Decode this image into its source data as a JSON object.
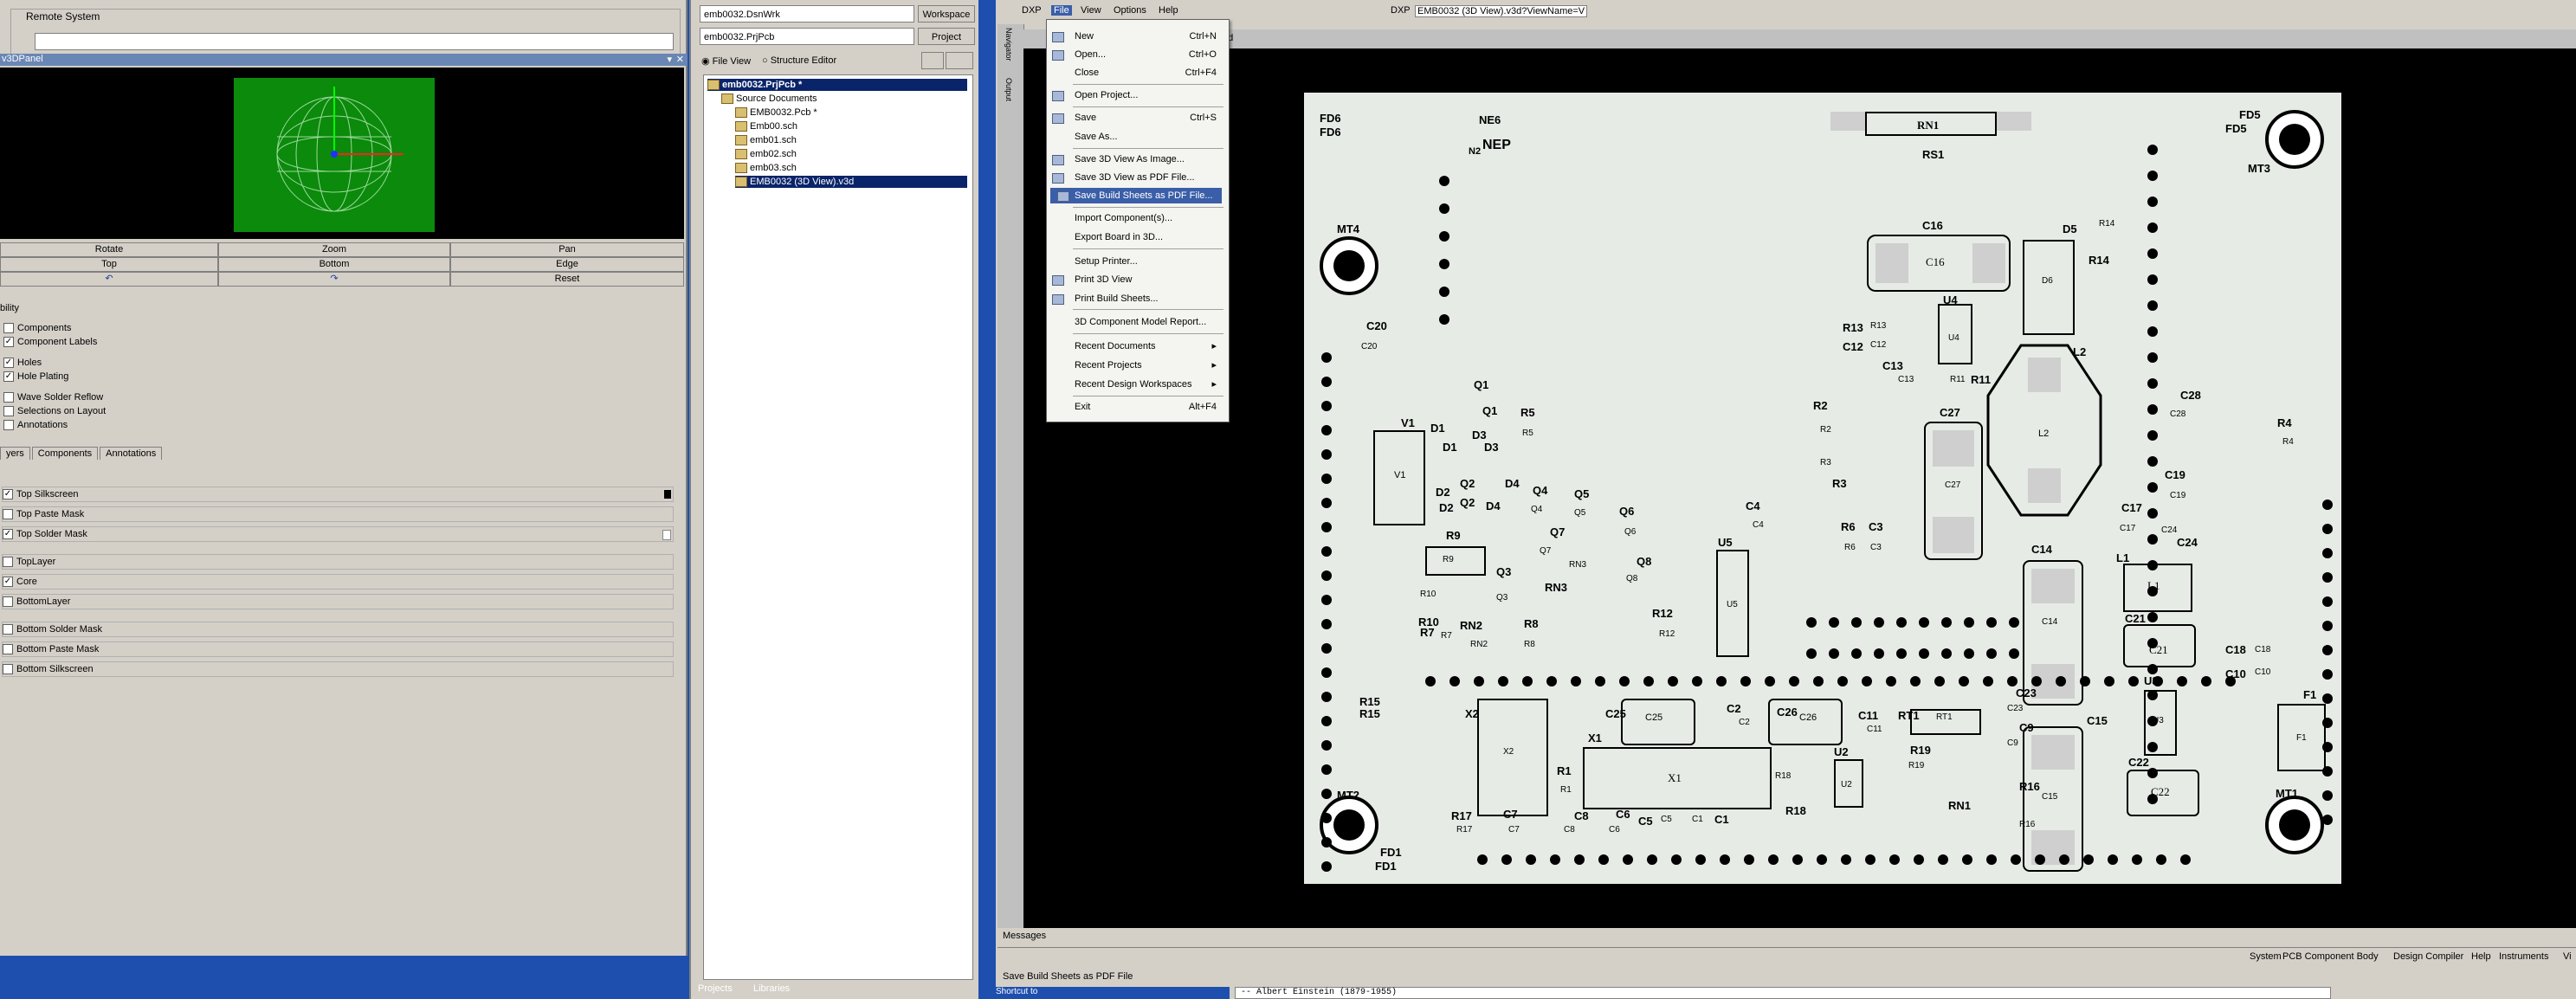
{
  "left_panel": {
    "remote_system_label": "Remote System",
    "panel_title": "v3DPanel",
    "controls": {
      "rotate": "Rotate",
      "zoom": "Zoom",
      "pan": "Pan",
      "top": "Top",
      "bottom": "Bottom",
      "edge": "Edge",
      "undo": "↶",
      "redo": "↷",
      "reset": "Reset"
    },
    "visibility_header": "bility",
    "visibility": [
      "Components",
      "Component Labels",
      "Holes",
      "Hole Plating",
      "Wave Solder Reflow",
      "Selections on Layout",
      "Annotations"
    ],
    "tabs": [
      "yers",
      "Components",
      "Annotations"
    ],
    "layers": [
      {
        "label": "Top Silkscreen",
        "checked": true
      },
      {
        "label": "Top Paste Mask",
        "checked": false
      },
      {
        "label": "Top Solder Mask",
        "checked": true
      },
      {
        "label": "TopLayer",
        "checked": false
      },
      {
        "label": "Core",
        "checked": true
      },
      {
        "label": "BottomLayer",
        "checked": false
      },
      {
        "label": "Bottom Solder Mask",
        "checked": false
      },
      {
        "label": "Bottom Paste Mask",
        "checked": false
      },
      {
        "label": "Bottom Silkscreen",
        "checked": false
      }
    ]
  },
  "projects_panel": {
    "workspace_combo": "emb0032.DsnWrk",
    "workspace_button": "Workspace",
    "project_combo": "emb0032.PrjPcb",
    "project_button": "Project",
    "file_view": "File View",
    "structure_editor": "Structure Editor",
    "tree": {
      "project": "emb0032.PrjPcb *",
      "folder": "Source Documents",
      "files": [
        "EMB0032.Pcb *",
        "Emb00.sch",
        "emb01.sch",
        "emb02.sch",
        "emb03.sch",
        "EMB0032 (3D View).v3d"
      ]
    },
    "bottom_tabs": [
      "Projects",
      "Libraries"
    ]
  },
  "main": {
    "menu": [
      "DXP",
      "File",
      "View",
      "Options",
      "Help"
    ],
    "toolbar_dxp": "DXP",
    "toolbar_combo": "EMB0032 (3D View).v3d?ViewName=V",
    "doc_tab": "3d",
    "side_tabs": [
      "Navigator",
      "Output"
    ],
    "messages_tab": "Messages",
    "status_text": "Save Build Sheets as PDF File",
    "status_right": [
      "System",
      "PCB Component Body",
      "Design Compiler",
      "Help",
      "Instruments",
      "Vi"
    ],
    "bottom_left_fragment": "Shortcut to",
    "bottom_quote": "-- Albert Einstein (1879-1955)"
  },
  "file_menu": {
    "items": [
      {
        "label": "New",
        "shortcut": "Ctrl+N",
        "submenu": true
      },
      {
        "label": "Open...",
        "shortcut": "Ctrl+O"
      },
      {
        "label": "Close",
        "shortcut": "Ctrl+F4"
      },
      {
        "label": "Open Project...",
        "shortcut": ""
      },
      {
        "label": "Save",
        "shortcut": "Ctrl+S"
      },
      {
        "label": "Save As...",
        "shortcut": ""
      },
      {
        "label": "Save 3D View As Image...",
        "shortcut": ""
      },
      {
        "label": "Save 3D View as PDF File...",
        "shortcut": ""
      },
      {
        "label": "Save Build Sheets as PDF File...",
        "shortcut": ""
      },
      {
        "label": "Import Component(s)...",
        "shortcut": ""
      },
      {
        "label": "Export Board in 3D...",
        "shortcut": ""
      },
      {
        "label": "Setup Printer...",
        "shortcut": ""
      },
      {
        "label": "Print 3D View",
        "shortcut": ""
      },
      {
        "label": "Print Build Sheets...",
        "shortcut": ""
      },
      {
        "label": "3D Component Model Report...",
        "shortcut": ""
      },
      {
        "label": "Recent Documents",
        "shortcut": "",
        "submenu": true
      },
      {
        "label": "Recent Projects",
        "shortcut": "",
        "submenu": true
      },
      {
        "label": "Recent Design Workspaces",
        "shortcut": "",
        "submenu": true
      },
      {
        "label": "Exit",
        "shortcut": "Alt+F4"
      }
    ]
  },
  "pcb": {
    "labels": [
      "FD6",
      "FD6",
      "NE6",
      "N2",
      "NEP",
      "RS1",
      "RN1",
      "FD5",
      "FD5",
      "MT3",
      "MT4",
      "C16",
      "C16",
      "D5",
      "D6",
      "R14",
      "R14",
      "C20",
      "C20",
      "U4",
      "U4",
      "R13",
      "R13",
      "C12",
      "C12",
      "C13",
      "C13",
      "R11",
      "R11",
      "L2",
      "L2",
      "Q1",
      "Q1",
      "R5",
      "R5",
      "V1",
      "V1",
      "D1",
      "D1",
      "D3",
      "D3",
      "Q2",
      "Q2",
      "D2",
      "D2",
      "D4",
      "D4",
      "R2",
      "R2",
      "R3",
      "R3",
      "C27",
      "C27",
      "C28",
      "C28",
      "R4",
      "R4",
      "Q4",
      "Q4",
      "Q5",
      "Q5",
      "Q6",
      "Q6",
      "Q7",
      "Q7",
      "RN3",
      "RN3",
      "Q8",
      "Q8",
      "R9",
      "R9",
      "R10",
      "R10",
      "Q3",
      "Q3",
      "R7",
      "R7",
      "R8",
      "R8",
      "RN2",
      "RN2",
      "C4",
      "C4",
      "U5",
      "U5",
      "R6",
      "R6",
      "C3",
      "C3",
      "C14",
      "C14",
      "L1",
      "L1",
      "C17",
      "C17",
      "C19",
      "C19",
      "C24",
      "C24",
      "R12",
      "R12",
      "C21",
      "C21",
      "C18",
      "C18",
      "C10",
      "C10",
      "U3",
      "U3",
      "F1",
      "F1",
      "R15",
      "R15",
      "X2",
      "X2",
      "C25",
      "C25",
      "C2",
      "C2",
      "C26",
      "C26",
      "C11",
      "C11",
      "RT1",
      "RT1",
      "C23",
      "C23",
      "C9",
      "C9",
      "C15",
      "C15",
      "X1",
      "X1",
      "R1",
      "R1",
      "U2",
      "U2",
      "R19",
      "R19",
      "RN1",
      "R18",
      "R18",
      "R16",
      "R16",
      "C22",
      "C22",
      "MT2",
      "R17",
      "R17",
      "C7",
      "C7",
      "C8",
      "C8",
      "C6",
      "C6",
      "C5",
      "C5",
      "C1",
      "C1",
      "FD1",
      "FD1",
      "MT1"
    ]
  }
}
